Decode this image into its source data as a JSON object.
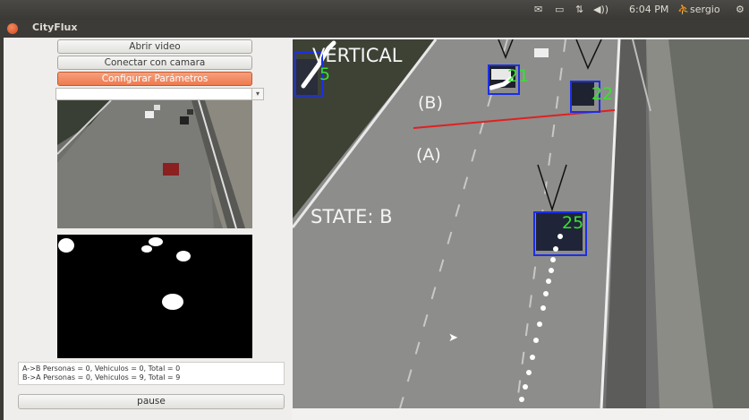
{
  "topbar": {
    "app_title": "CityFlux",
    "clock": "6:04 PM",
    "user": "sergio"
  },
  "controls": {
    "open_video": "Abrir video",
    "connect_camera": "Conectar con camara",
    "configure": "Configurar Parámetros",
    "pause": "pause"
  },
  "counts": {
    "line1": "A->B  Personas = 0, Vehiculos = 0, Total = 0",
    "line2": "B->A  Personas = 0, Vehiculos = 9, Total = 9"
  },
  "video": {
    "mode_label": "VERTICAL",
    "region_b": "(B)",
    "region_a": "(A)",
    "state_label": "STATE: B",
    "detections": [
      "5",
      "21",
      "22",
      "25"
    ]
  },
  "colors": {
    "accent": "#ee7a4f",
    "box": "#1b2fe6",
    "id_text": "#39e032",
    "line": "#e02020"
  }
}
